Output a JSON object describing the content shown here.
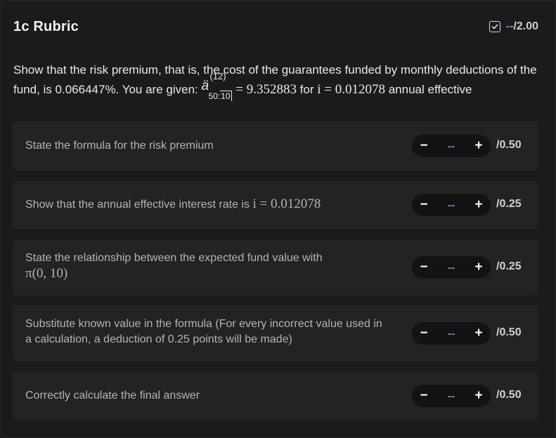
{
  "header": {
    "title": "1c Rubric",
    "score_dash": "--",
    "score_total": "/2.00"
  },
  "question": {
    "text_before": "Show that the risk premium, that is, the cost of the guarantees funded by monthly deductions of the fund, is 0.066447%. You are given: ",
    "annuity_symbol": "ä",
    "annuity_sup": "(12)",
    "annuity_sub_left": "50:",
    "annuity_sub_right": "10",
    "eq_value": " = 9.352883",
    "text_mid": " for ",
    "math_i": "i = 0.012078",
    "text_after": " annual effective"
  },
  "rubric_items": [
    {
      "label": "State the formula for the risk premium",
      "value": "--",
      "points": "/0.50"
    },
    {
      "label": "Show that the annual effective interest rate is ",
      "math": "i = 0.012078",
      "value": "--",
      "points": "/0.25"
    },
    {
      "label": "State the relationship between the expected fund value with",
      "math": "π(0, 10)",
      "value": "--",
      "points": "/0.25"
    },
    {
      "label": "Substitute known value in the formula (For every incorrect value used in a calculation, a deduction of 0.25 points will be made)",
      "value": "--",
      "points": "/0.50"
    },
    {
      "label": "Correctly calculate the final answer",
      "value": "--",
      "points": "/0.50"
    }
  ],
  "stepper": {
    "minus": "−",
    "plus": "+"
  },
  "icons": {
    "status": "checkbox-check-icon"
  },
  "colors": {
    "accent": "#8e8ae0",
    "background": "#1b1b1d",
    "card": "#232326"
  }
}
